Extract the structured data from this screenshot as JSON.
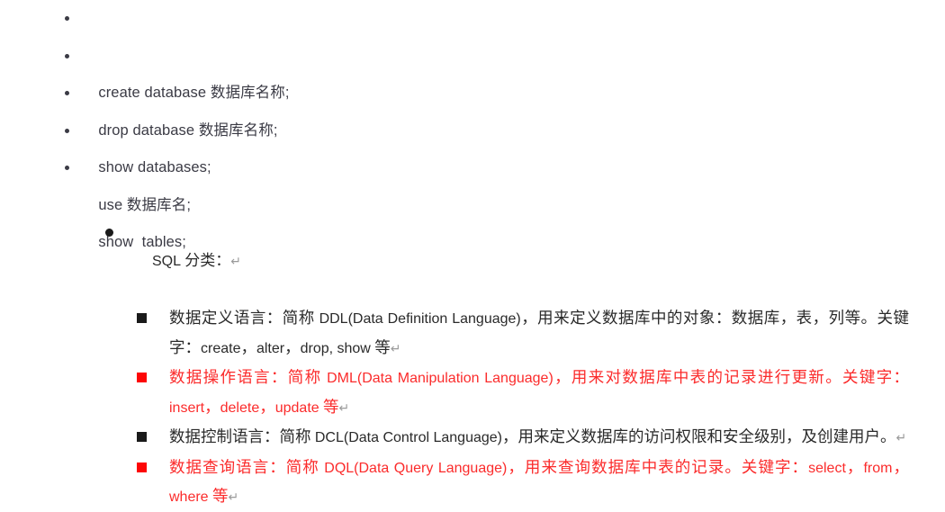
{
  "page": {
    "background": "#ffffff",
    "text_color_default": "#3b3b45",
    "text_color_doc": "#2a2a2a",
    "text_color_highlight": "#fb2b2b",
    "return_mark": "↵"
  },
  "top_list": {
    "bullet_glyph": "•",
    "items": [
      {
        "text": "create database 数据库名称;"
      },
      {
        "text": "drop database 数据库名称;"
      },
      {
        "text": "show databases;"
      },
      {
        "text": "use 数据库名;"
      },
      {
        "text": "show  tables;"
      }
    ]
  },
  "outline": {
    "level1": {
      "bullet_glyph": "●",
      "cjk_before": "",
      "latin": "SQL",
      "cjk_after": " 分类：",
      "return_mark": "↵"
    },
    "level2_bullet_glyph": "■",
    "items": [
      {
        "id": "ddl",
        "color": "#2a2a2a",
        "highlighted": false,
        "seg1": "数据定义语言：简称 ",
        "latin1": "DDL(Data Definition Language)",
        "seg2": "，用来定义数据库中的对象：数据库，表，列等。关键字：",
        "latin2": "create",
        "seg3": "，",
        "latin3": "alter",
        "seg4": "，",
        "latin4": "drop, show",
        "seg5": " 等",
        "return_mark": "↵"
      },
      {
        "id": "dml",
        "color": "#fb2b2b",
        "highlighted": true,
        "seg1": "数据操作语言：简称 ",
        "latin1": "DML(Data Manipulation Language)",
        "seg2": "，用来对数据库中表的记录进行更新。关键字：",
        "latin2": "insert",
        "seg3": "，",
        "latin3": "delete",
        "seg4": "，",
        "latin4": "update",
        "seg5": " 等",
        "return_mark": "↵"
      },
      {
        "id": "dcl",
        "color": "#2a2a2a",
        "highlighted": false,
        "seg1": "数据控制语言：简称 ",
        "latin1": "DCL(Data Control Language)",
        "seg2": "，用来定义数据库的访问权限和安全级别，及创建用户。",
        "latin2": "",
        "seg3": "",
        "latin3": "",
        "seg4": "",
        "latin4": "",
        "seg5": "",
        "return_mark": "↵"
      },
      {
        "id": "dql",
        "color": "#fb2b2b",
        "highlighted": true,
        "seg1": "数据查询语言：简称 ",
        "latin1": "DQL(Data Query Language)",
        "seg2": "，用来查询数据库中表的记录。关键字：",
        "latin2": "select",
        "seg3": "，",
        "latin3": "from",
        "seg4": "，",
        "latin4": "where",
        "seg5": " 等",
        "return_mark": "↵"
      }
    ]
  }
}
